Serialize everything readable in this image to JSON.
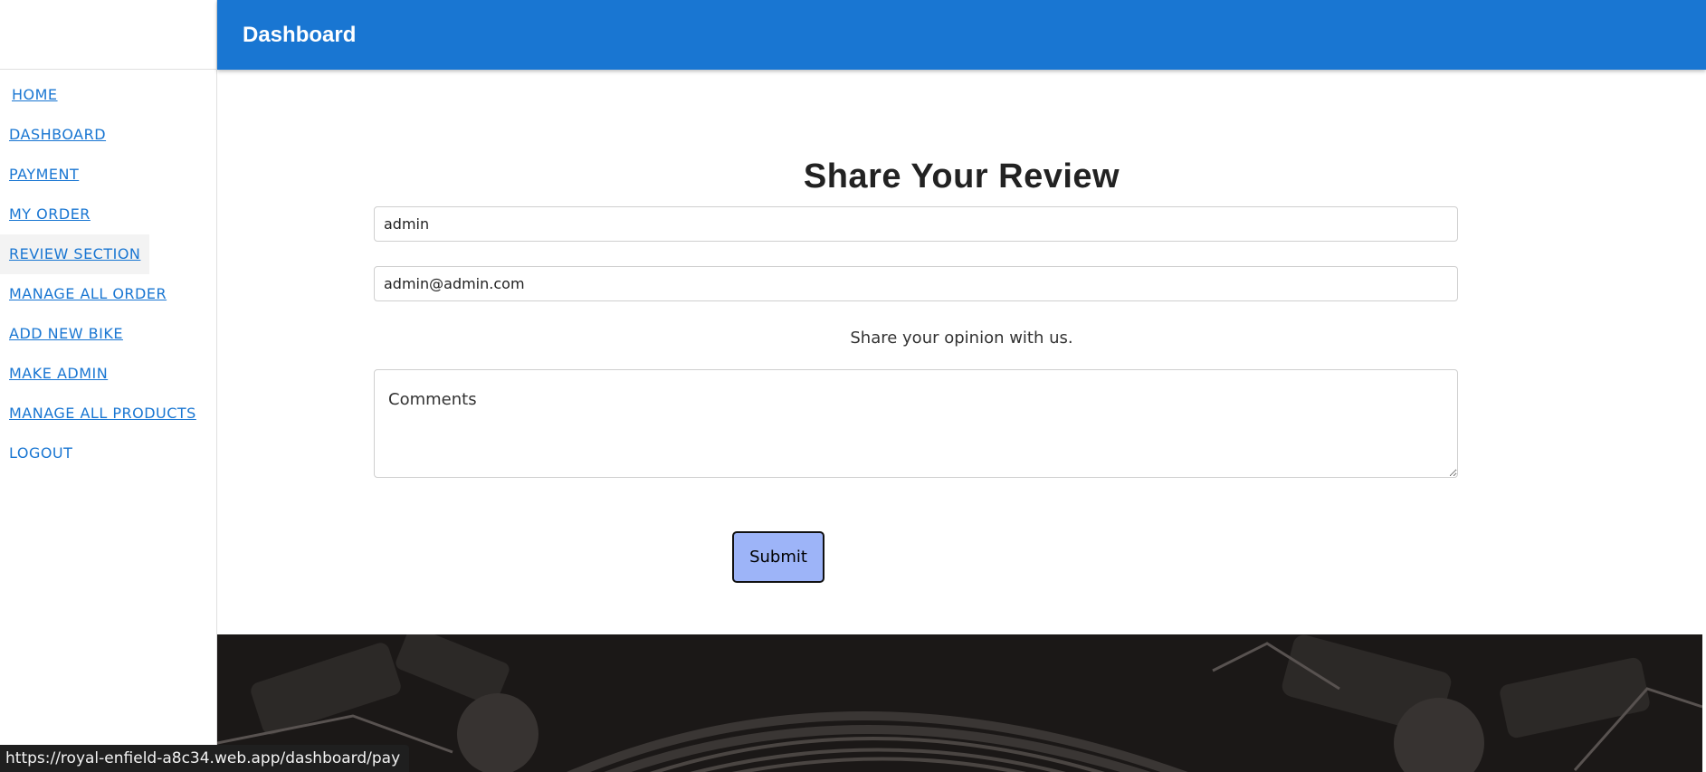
{
  "appbar": {
    "title": "Dashboard"
  },
  "sidebar": {
    "items": [
      {
        "label": "HOME"
      },
      {
        "label": "DASHBOARD"
      },
      {
        "label": "PAYMENT"
      },
      {
        "label": "MY ORDER"
      },
      {
        "label": "REVIEW SECTION"
      },
      {
        "label": "MANAGE ALL ORDER"
      },
      {
        "label": "ADD NEW BIKE"
      },
      {
        "label": "MAKE ADMIN"
      },
      {
        "label": "MANAGE ALL PRODUCTS"
      },
      {
        "label": "LOGOUT"
      }
    ]
  },
  "form": {
    "title": "Share Your Review",
    "name_value": "admin",
    "email_value": "admin@admin.com",
    "opinion_text": "Share your opinion with us.",
    "comments_placeholder": "Comments",
    "submit_label": "Submit"
  },
  "status_bar": {
    "url": "https://royal-enfield-a8c34.web.app/dashboard/pay"
  },
  "colors": {
    "appbar_bg": "#1976d2",
    "link": "#1976d2",
    "submit_bg": "#9db4f8"
  }
}
